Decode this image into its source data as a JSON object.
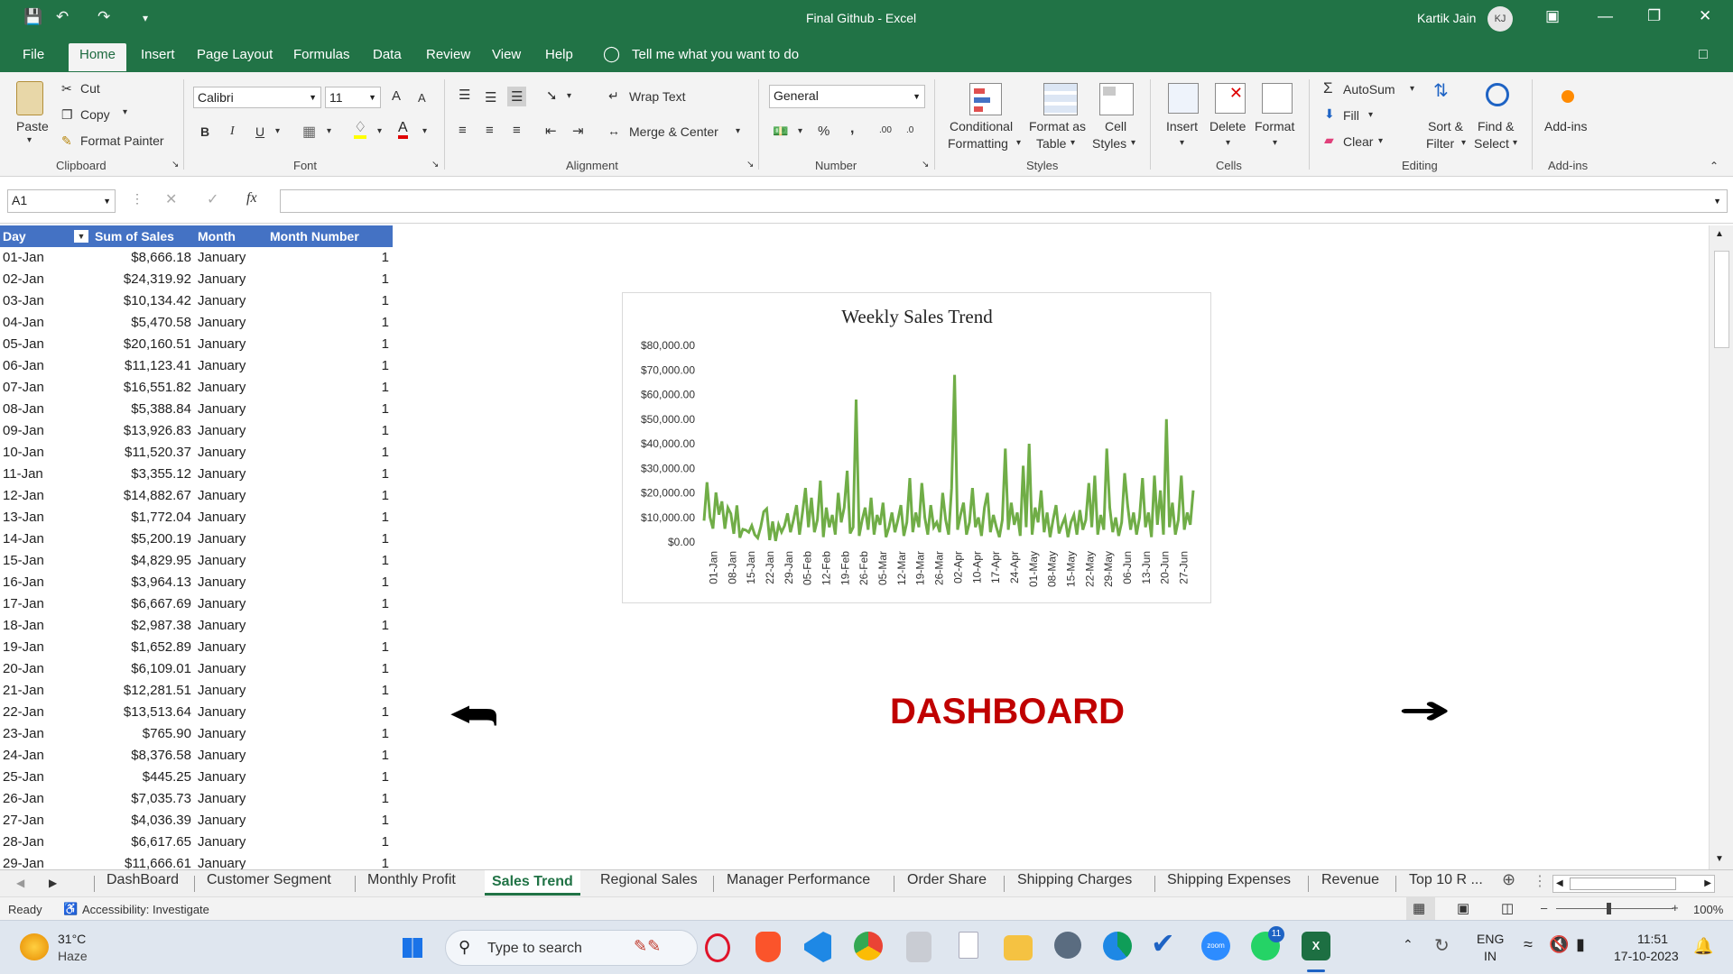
{
  "window": {
    "title": "Final Github  -  Excel",
    "user": "Kartik Jain",
    "user_initials": "KJ"
  },
  "menu": {
    "tabs": [
      "File",
      "Home",
      "Insert",
      "Page Layout",
      "Formulas",
      "Data",
      "Review",
      "View",
      "Help"
    ],
    "tell_me": "Tell me what you want to do"
  },
  "ribbon": {
    "clipboard": {
      "paste": "Paste",
      "cut": "Cut",
      "copy": "Copy",
      "format_painter": "Format Painter",
      "group": "Clipboard"
    },
    "font": {
      "name": "Calibri",
      "size": "11",
      "group": "Font",
      "bold": "B",
      "italic": "I",
      "underline": "U",
      "grow": "A",
      "shrink": "A"
    },
    "alignment": {
      "wrap": "Wrap Text",
      "merge": "Merge & Center",
      "group": "Alignment"
    },
    "number": {
      "format": "General",
      "group": "Number",
      "percent": "%",
      "comma": ",",
      "inc_decimal": ".00",
      "dec_decimal": ".0"
    },
    "styles": {
      "conditional": "Conditional",
      "conditional2": "Formatting",
      "format_as": "Format as",
      "format_as2": "Table",
      "cell": "Cell",
      "cell2": "Styles",
      "group": "Styles"
    },
    "cells": {
      "insert": "Insert",
      "delete": "Delete",
      "format": "Format",
      "group": "Cells"
    },
    "editing": {
      "autosum": "AutoSum",
      "fill": "Fill",
      "clear": "Clear",
      "sort": "Sort &",
      "sort2": "Filter",
      "find": "Find &",
      "find2": "Select",
      "group": "Editing"
    },
    "addins": {
      "label": "Add-ins",
      "group": "Add-ins"
    }
  },
  "formula_bar": {
    "name_box": "A1",
    "fx": "fx",
    "formula": ""
  },
  "table": {
    "headers": [
      "Day",
      "Sum of Sales",
      "Month",
      "Month Number"
    ],
    "rows": [
      [
        "01-Jan",
        "$8,666.18",
        "January",
        "1"
      ],
      [
        "02-Jan",
        "$24,319.92",
        "January",
        "1"
      ],
      [
        "03-Jan",
        "$10,134.42",
        "January",
        "1"
      ],
      [
        "04-Jan",
        "$5,470.58",
        "January",
        "1"
      ],
      [
        "05-Jan",
        "$20,160.51",
        "January",
        "1"
      ],
      [
        "06-Jan",
        "$11,123.41",
        "January",
        "1"
      ],
      [
        "07-Jan",
        "$16,551.82",
        "January",
        "1"
      ],
      [
        "08-Jan",
        "$5,388.84",
        "January",
        "1"
      ],
      [
        "09-Jan",
        "$13,926.83",
        "January",
        "1"
      ],
      [
        "10-Jan",
        "$11,520.37",
        "January",
        "1"
      ],
      [
        "11-Jan",
        "$3,355.12",
        "January",
        "1"
      ],
      [
        "12-Jan",
        "$14,882.67",
        "January",
        "1"
      ],
      [
        "13-Jan",
        "$1,772.04",
        "January",
        "1"
      ],
      [
        "14-Jan",
        "$5,200.19",
        "January",
        "1"
      ],
      [
        "15-Jan",
        "$4,829.95",
        "January",
        "1"
      ],
      [
        "16-Jan",
        "$3,964.13",
        "January",
        "1"
      ],
      [
        "17-Jan",
        "$6,667.69",
        "January",
        "1"
      ],
      [
        "18-Jan",
        "$2,987.38",
        "January",
        "1"
      ],
      [
        "19-Jan",
        "$1,652.89",
        "January",
        "1"
      ],
      [
        "20-Jan",
        "$6,109.01",
        "January",
        "1"
      ],
      [
        "21-Jan",
        "$12,281.51",
        "January",
        "1"
      ],
      [
        "22-Jan",
        "$13,513.64",
        "January",
        "1"
      ],
      [
        "23-Jan",
        "$765.90",
        "January",
        "1"
      ],
      [
        "24-Jan",
        "$8,376.58",
        "January",
        "1"
      ],
      [
        "25-Jan",
        "$445.25",
        "January",
        "1"
      ],
      [
        "26-Jan",
        "$7,035.73",
        "January",
        "1"
      ],
      [
        "27-Jan",
        "$4,036.39",
        "January",
        "1"
      ],
      [
        "28-Jan",
        "$6,617.65",
        "January",
        "1"
      ],
      [
        "29-Jan",
        "$11,666.61",
        "January",
        "1"
      ]
    ]
  },
  "chart_data": {
    "type": "line",
    "title": "Weekly Sales Trend",
    "ylim": [
      0,
      80000
    ],
    "y_ticks": [
      "$0.00",
      "$10,000.00",
      "$20,000.00",
      "$30,000.00",
      "$40,000.00",
      "$50,000.00",
      "$60,000.00",
      "$70,000.00",
      "$80,000.00"
    ],
    "x_ticks": [
      "01-Jan",
      "08-Jan",
      "15-Jan",
      "22-Jan",
      "29-Jan",
      "05-Feb",
      "12-Feb",
      "19-Feb",
      "26-Feb",
      "05-Mar",
      "12-Mar",
      "19-Mar",
      "26-Mar",
      "02-Apr",
      "10-Apr",
      "17-Apr",
      "24-Apr",
      "01-May",
      "08-May",
      "15-May",
      "22-May",
      "29-May",
      "06-Jun",
      "13-Jun",
      "20-Jun",
      "27-Jun"
    ],
    "color": "#70ad47",
    "grid": false,
    "legend": "none",
    "values": [
      8666.18,
      24319.92,
      10134.42,
      5470.58,
      20160.51,
      11123.41,
      16551.82,
      5388.84,
      13926.83,
      11520.37,
      3355.12,
      14882.67,
      1772.04,
      5200.19,
      4829.95,
      3964.13,
      6667.69,
      2987.38,
      1652.89,
      6109.01,
      12281.51,
      13513.64,
      765.9,
      8376.58,
      445.25,
      7035.73,
      4036.39,
      6617.65,
      11666.61,
      4000,
      9000,
      15000,
      3000,
      12000,
      22000,
      6000,
      18000,
      4000,
      9000,
      25000,
      2000,
      14000,
      6000,
      11000,
      3000,
      20000,
      8000,
      14000,
      29000,
      3500,
      6000,
      58000,
      2500,
      9000,
      14000,
      5000,
      18000,
      3000,
      11000,
      7000,
      16000,
      2000,
      6000,
      12000,
      4000,
      9000,
      15000,
      2500,
      8000,
      26000,
      4000,
      12000,
      6000,
      24000,
      10000,
      3000,
      15000,
      6000,
      8000,
      4000,
      20000,
      9000,
      3000,
      22000,
      68000,
      5000,
      11000,
      16000,
      3000,
      8000,
      22000,
      6000,
      10000,
      2500,
      14000,
      20000,
      4000,
      11000,
      6000,
      2000,
      9000,
      38000,
      5000,
      16000,
      7000,
      12000,
      2500,
      31000,
      6000,
      40000,
      3000,
      14000,
      8000,
      21000,
      4000,
      12000,
      2000,
      9000,
      15000,
      3500,
      7000,
      10000,
      2000,
      8000,
      11000,
      3000,
      13000,
      5000,
      9000,
      24000,
      6000,
      27000,
      3000,
      11000,
      5000,
      38000,
      14000,
      4000,
      10000,
      2500,
      8000,
      28000,
      15000,
      5000,
      12000,
      3000,
      10000,
      26000,
      6000,
      12000,
      2000,
      27000,
      7000,
      21000,
      3000,
      50000,
      6000,
      16000,
      3000,
      9000,
      27000,
      5000,
      12000,
      7000,
      21000
    ]
  },
  "dashboard_label": "DASHBOARD",
  "sheets": [
    "DashBoard",
    "Customer Segment",
    "Monthly Profit",
    "Sales Trend",
    "Regional Sales",
    "Manager Performance",
    "Order Share",
    "Shipping Charges",
    "Shipping Expenses",
    "Revenue",
    "Top 10 R ..."
  ],
  "active_sheet": "Sales Trend",
  "status": {
    "ready": "Ready",
    "accessibility": "Accessibility: Investigate",
    "zoom": "100%"
  },
  "taskbar": {
    "weather_temp": "31°C",
    "weather_desc": "Haze",
    "search_placeholder": "Type to search",
    "lang1": "ENG",
    "lang2": "IN",
    "time": "11:51",
    "date": "17-10-2023",
    "badge": "11"
  }
}
